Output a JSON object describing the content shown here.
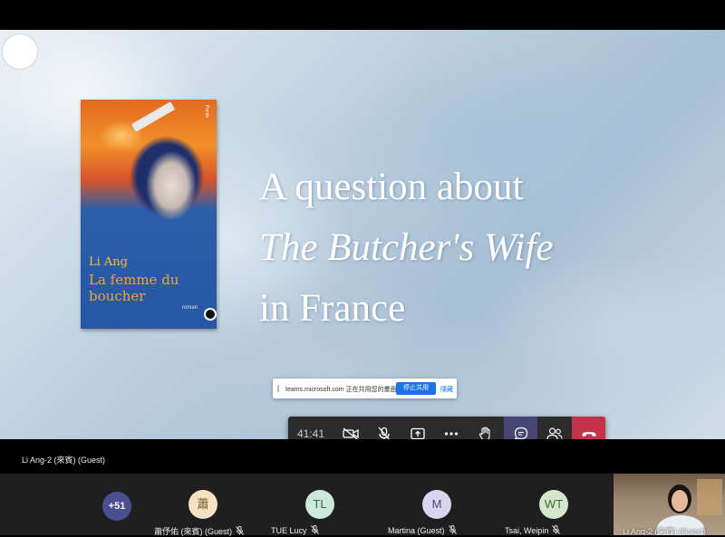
{
  "slide": {
    "title_line1": "A question about",
    "title_line2": "The Butcher's Wife",
    "title_line3": "in France",
    "book_cover": {
      "spine_label": "Points",
      "author": "Li Ang",
      "title": "La femme du boucher",
      "genre": "roman"
    }
  },
  "share_notice": {
    "text": "teams.microsoft.com 正在共用您的畫面。",
    "stop_label": "停止共用",
    "hide_label": "隱藏"
  },
  "call_controls": {
    "timer": "41:41",
    "buttons": [
      {
        "icon": "camera-off-icon"
      },
      {
        "icon": "mic-off-icon"
      },
      {
        "icon": "share-screen-icon"
      },
      {
        "icon": "more-options-icon"
      },
      {
        "icon": "raise-hand-icon"
      },
      {
        "icon": "chat-icon"
      },
      {
        "icon": "participants-icon"
      },
      {
        "icon": "hang-up-icon"
      }
    ],
    "hangup_color": "#c4314b",
    "active_color": "#464775"
  },
  "presenter_caption": "Li Ang-2 (來賓) (Guest)",
  "participants": {
    "more_count": "+51",
    "tiles": [
      {
        "initials": "蕭",
        "name": "蕭伃佑 (來賓) (Guest)",
        "avatar_bg": "#f3e3c3",
        "avatar_fg": "#7a5a2a"
      },
      {
        "initials": "TL",
        "name": "TUE Lucy",
        "avatar_bg": "#cde8dc",
        "avatar_fg": "#2f6b4f"
      },
      {
        "initials": "M",
        "name": "Martina (Guest)",
        "avatar_bg": "#d9d5ee",
        "avatar_fg": "#4b4580"
      },
      {
        "initials": "WT",
        "name": "Tsai, Weipin",
        "avatar_bg": "#d4e6cc",
        "avatar_fg": "#3f6a33"
      }
    ],
    "self_name": "Li Ang-2 (來賓) (Guest)"
  }
}
